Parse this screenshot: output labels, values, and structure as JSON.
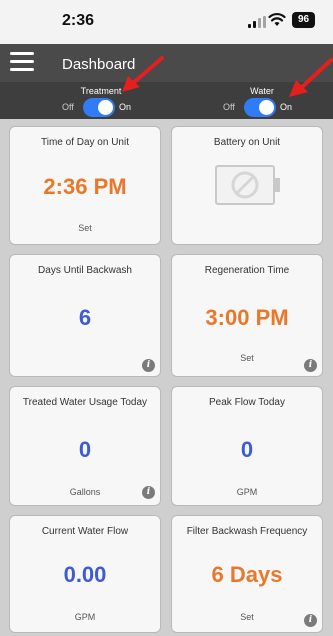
{
  "status": {
    "time": "2:36",
    "battery": "96"
  },
  "header": {
    "title": "Dashboard"
  },
  "toggles": {
    "treatment": {
      "label": "Treatment",
      "off": "Off",
      "on": "On"
    },
    "water": {
      "label": "Water",
      "off": "Off",
      "on": "On"
    }
  },
  "cards": {
    "time_of_day": {
      "title": "Time of Day on Unit",
      "value": "2:36 PM",
      "sub": "Set"
    },
    "battery": {
      "title": "Battery on Unit"
    },
    "days_backwash": {
      "title": "Days Until Backwash",
      "value": "6"
    },
    "regen_time": {
      "title": "Regeneration Time",
      "value": "3:00 PM",
      "sub": "Set"
    },
    "treated_usage": {
      "title": "Treated Water Usage Today",
      "value": "0",
      "sub": "Gallons"
    },
    "peak_flow": {
      "title": "Peak Flow Today",
      "value": "0",
      "sub": "GPM"
    },
    "current_flow": {
      "title": "Current Water Flow",
      "value": "0.00",
      "sub": "GPM"
    },
    "backwash_freq": {
      "title": "Filter Backwash Frequency",
      "value": "6 Days",
      "sub": "Set"
    }
  },
  "info_icon_glyph": "i",
  "colors": {
    "accent_orange": "#e9782a",
    "accent_blue": "#3d5bd6",
    "toggle_on": "#2f7cf6"
  }
}
